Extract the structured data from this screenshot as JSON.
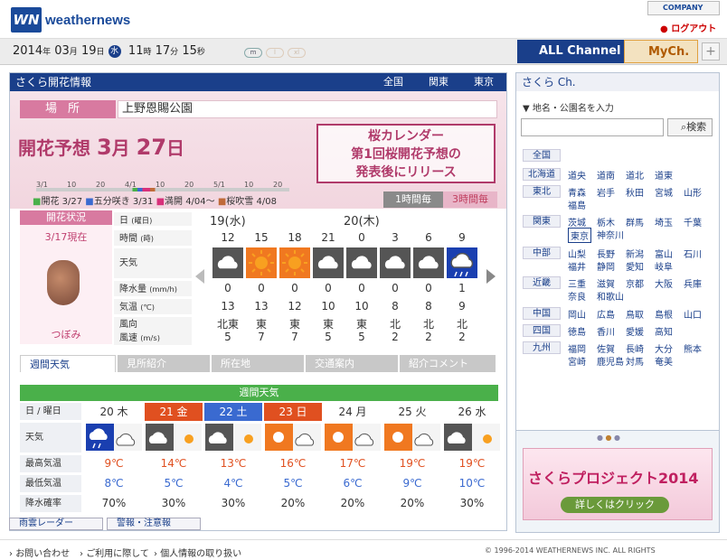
{
  "header": {
    "logo_mark": "WN",
    "logo_text": "weathernews",
    "company": "COMPANY",
    "logout": "ログアウト"
  },
  "datebar": {
    "year": "2014",
    "year_unit": "年",
    "month": "03",
    "month_unit": "月",
    "day": "19",
    "day_unit": "日",
    "weekday": "水",
    "hour": "11",
    "hour_unit": "時",
    "minute": "17",
    "minute_unit": "分",
    "second": "15",
    "second_unit": "秒",
    "sizes": [
      "m",
      "l",
      "xl"
    ]
  },
  "channels": {
    "all": "ALL Channel",
    "my": "MyCh.",
    "plus": "+"
  },
  "main": {
    "title": "さくら開花情報",
    "regions": [
      "全国",
      "関東",
      "東京"
    ],
    "place_label": "場所",
    "place_value": "上野恩賜公園",
    "forecast_label": "開花予想",
    "forecast_month": "3",
    "forecast_month_unit": "月",
    "forecast_day": "27",
    "forecast_day_unit": "日",
    "calendar_banner": [
      "桜カレンダー",
      "第1回桜開花予想の",
      "発表後にリリース"
    ],
    "timeline_labels": [
      "3/1",
      "10",
      "20",
      "4/1",
      "10",
      "20",
      "5/1",
      "10",
      "20"
    ],
    "legend": [
      {
        "label": "開花 3/27",
        "color": "#4ab04a"
      },
      {
        "label": "五分咲き 3/31",
        "color": "#3a6ad0"
      },
      {
        "label": "満開 4/04〜",
        "color": "#d8307a"
      },
      {
        "label": "桜吹雪 4/08",
        "color": "#c06a3a"
      }
    ],
    "hour_tabs": [
      "1時間毎",
      "3時間毎"
    ],
    "status_label": "開花状況",
    "status_date": "3/17現在",
    "status_value": "つぼみ",
    "hourly": {
      "labels": {
        "date": "日",
        "date_unit": "(曜日)",
        "time": "時間",
        "time_unit": "(時)",
        "weather": "天気",
        "precip": "降水量",
        "precip_unit": "(mm/h)",
        "temp": "気温",
        "temp_unit": "(℃)",
        "wind_dir": "風向",
        "wind_speed": "風速",
        "wind_unit": "(m/s)"
      },
      "dates": [
        "19(水)",
        "20(木)"
      ],
      "hours": [
        "12",
        "15",
        "18",
        "21",
        "0",
        "3",
        "6",
        "9"
      ],
      "weather": [
        "cloudy-icon",
        "sunny-icon",
        "sunny-icon",
        "cloudy-icon",
        "cloudy-icon",
        "cloudy-icon",
        "cloudy-icon",
        "rain-icon"
      ],
      "precip": [
        "0",
        "0",
        "0",
        "0",
        "0",
        "0",
        "0",
        "1"
      ],
      "temp": [
        "13",
        "13",
        "12",
        "10",
        "10",
        "8",
        "8",
        "9"
      ],
      "wind_dir": [
        "北東",
        "東",
        "東",
        "東",
        "東",
        "北",
        "北",
        "北"
      ],
      "wind_speed": [
        "5",
        "7",
        "7",
        "5",
        "5",
        "2",
        "2",
        "2"
      ]
    },
    "tabs": [
      "週間天気",
      "見所紹介",
      "所在地",
      "交通案内",
      "紹介コメント"
    ],
    "weekly": {
      "title": "週間天気",
      "label_date": "日 / 曜日",
      "label_weather": "天気",
      "label_high": "最高気温",
      "label_low": "最低気温",
      "label_pop": "降水確率",
      "days": [
        {
          "day": "20",
          "wd": "木",
          "bg": "#fff",
          "fg": "#333",
          "weather": "rain-cloudy-icon",
          "high": "9℃",
          "low": "8℃",
          "pop": "70%"
        },
        {
          "day": "21",
          "wd": "金",
          "bg": "#e05020",
          "fg": "#fff",
          "weather": "cloudy-sunny-icon",
          "high": "14℃",
          "low": "5℃",
          "pop": "30%"
        },
        {
          "day": "22",
          "wd": "土",
          "bg": "#3a6ad0",
          "fg": "#fff",
          "weather": "cloudy-sunny-icon",
          "high": "13℃",
          "low": "4℃",
          "pop": "30%"
        },
        {
          "day": "23",
          "wd": "日",
          "bg": "#e05020",
          "fg": "#fff",
          "weather": "sunny-cloudy-icon",
          "high": "16℃",
          "low": "5℃",
          "pop": "20%"
        },
        {
          "day": "24",
          "wd": "月",
          "bg": "#fff",
          "fg": "#333",
          "weather": "sunny-cloudy-icon",
          "high": "17℃",
          "low": "6℃",
          "pop": "20%"
        },
        {
          "day": "25",
          "wd": "火",
          "bg": "#fff",
          "fg": "#333",
          "weather": "sunny-cloudy-icon",
          "high": "19℃",
          "low": "9℃",
          "pop": "20%"
        },
        {
          "day": "26",
          "wd": "水",
          "bg": "#fff",
          "fg": "#333",
          "weather": "cloudy-sunny-icon",
          "high": "19℃",
          "low": "10℃",
          "pop": "30%"
        }
      ]
    },
    "bottom_links": [
      "雨雲レーダー",
      "警報・注意報"
    ]
  },
  "sidebar": {
    "title": "さくら Ch.",
    "search_label": "▼ 地名・公園名を入力",
    "search_button": "検索",
    "regions": [
      {
        "name": "全国",
        "prefs": []
      },
      {
        "name": "北海道",
        "prefs": [
          "道央",
          "道南",
          "道北",
          "道東"
        ]
      },
      {
        "name": "東北",
        "prefs": [
          "青森",
          "岩手",
          "秋田",
          "宮城",
          "山形",
          "福島"
        ]
      },
      {
        "name": "関東",
        "prefs": [
          "茨城",
          "栃木",
          "群馬",
          "埼玉",
          "千葉",
          "東京",
          "神奈川"
        ]
      },
      {
        "name": "中部",
        "prefs": [
          "山梨",
          "長野",
          "新潟",
          "富山",
          "石川",
          "福井",
          "静岡",
          "愛知",
          "岐阜"
        ]
      },
      {
        "name": "近畿",
        "prefs": [
          "三重",
          "滋賀",
          "京都",
          "大阪",
          "兵庫",
          "奈良",
          "和歌山"
        ]
      },
      {
        "name": "中国",
        "prefs": [
          "岡山",
          "広島",
          "鳥取",
          "島根",
          "山口"
        ]
      },
      {
        "name": "四国",
        "prefs": [
          "徳島",
          "香川",
          "愛媛",
          "高知"
        ]
      },
      {
        "name": "九州",
        "prefs": [
          "福岡",
          "佐賀",
          "長崎",
          "大分",
          "熊本",
          "宮崎",
          "鹿児島",
          "対馬",
          "奄美"
        ]
      }
    ],
    "promo_title": "さくらプロジェクト2014",
    "promo_button": "詳しくはクリック"
  },
  "footer": {
    "links": [
      "お問い合わせ",
      "ご利用に際して",
      "個人情報の取り扱い"
    ],
    "copyright": "1996-2014 WEATHERNEWS INC. ALL RIGHTS"
  }
}
